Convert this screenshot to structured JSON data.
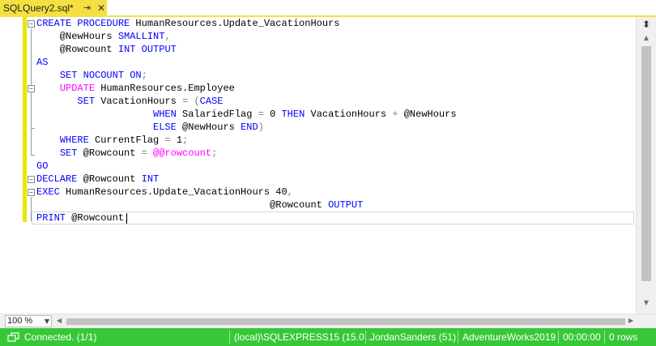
{
  "tab": {
    "title": "SQLQuery2.sql*",
    "pin_icon": "pin-icon",
    "close_icon": "close-icon"
  },
  "editor": {
    "lines": [
      "CREATE PROCEDURE HumanResources.Update_VacationHours",
      "@NewHours SMALLINT,",
      "@Rowcount INT OUTPUT",
      "AS",
      "SET NOCOUNT ON;",
      "UPDATE HumanResources.Employee",
      "SET VacationHours = (CASE",
      "WHEN SalariedFlag = 0 THEN VacationHours + @NewHours",
      "ELSE @NewHours END)",
      "WHERE CurrentFlag = 1;",
      "SET @Rowcount = @@rowcount;",
      "GO",
      "DECLARE @Rowcount INT",
      "EXEC HumanResources.Update_VacationHours 40,",
      "@Rowcount OUTPUT",
      "PRINT @Rowcount;"
    ]
  },
  "zoom": {
    "value": "100 %"
  },
  "status": {
    "connection": "Connected. (1/1)",
    "server": "(local)\\SQLEXPRESS15 (15.0 ...",
    "user": "JordanSanders (51)",
    "database": "AdventureWorks2019",
    "elapsed": "00:00:00",
    "rows": "0 rows",
    "color": "#37c837"
  },
  "colors": {
    "keyword": "#0000ff",
    "function": "#ff00ff",
    "operator": "#808080",
    "tab_accent": "#f5e042"
  }
}
